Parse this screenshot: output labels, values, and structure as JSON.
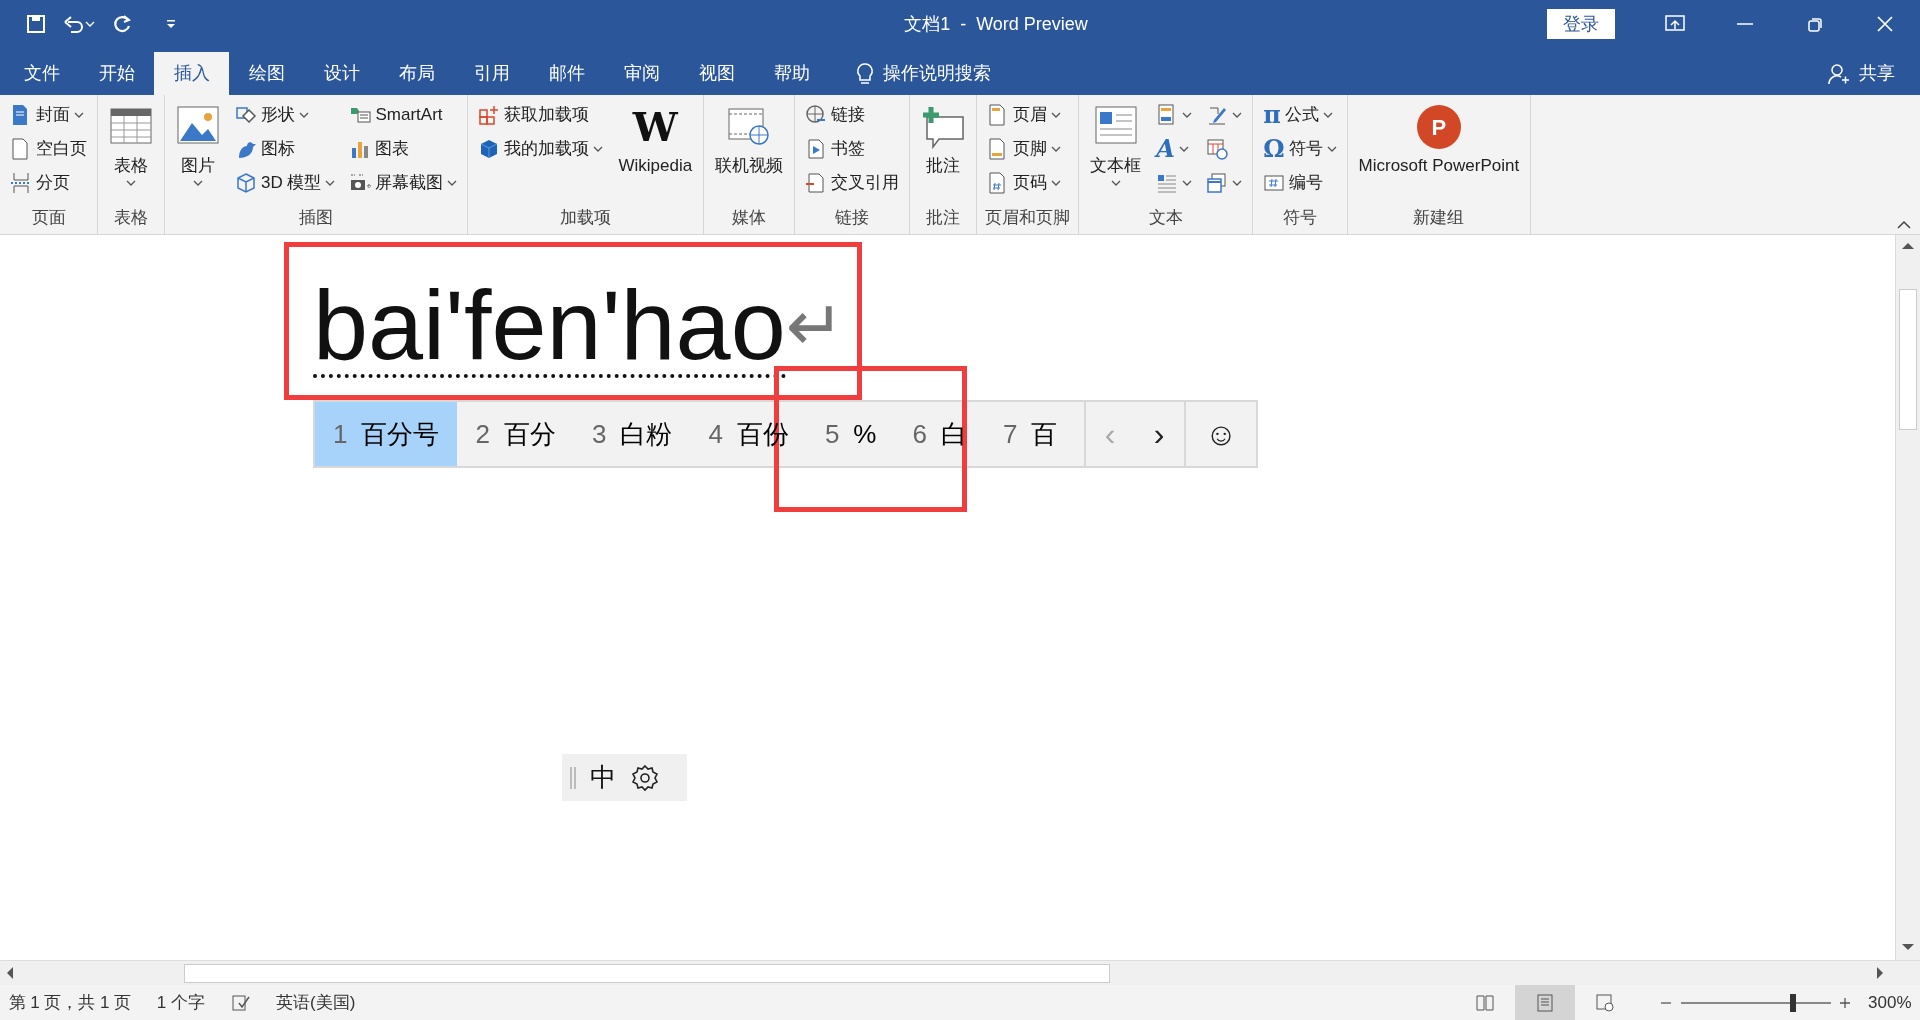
{
  "window": {
    "title": "文档1  -  Word Preview",
    "login_button": "登录"
  },
  "tabs": [
    {
      "label": "文件",
      "selected": false
    },
    {
      "label": "开始",
      "selected": false
    },
    {
      "label": "插入",
      "selected": true
    },
    {
      "label": "绘图",
      "selected": false
    },
    {
      "label": "设计",
      "selected": false
    },
    {
      "label": "布局",
      "selected": false
    },
    {
      "label": "引用",
      "selected": false
    },
    {
      "label": "邮件",
      "selected": false
    },
    {
      "label": "审阅",
      "selected": false
    },
    {
      "label": "视图",
      "selected": false
    },
    {
      "label": "帮助",
      "selected": false
    }
  ],
  "tell_me": "操作说明搜索",
  "share": "共享",
  "ribbon": {
    "groups": [
      {
        "label": "页面",
        "items": [
          {
            "label": "封面",
            "kind": "small",
            "dropdown": true
          },
          {
            "label": "空白页",
            "kind": "small",
            "dropdown": false
          },
          {
            "label": "分页",
            "kind": "small",
            "dropdown": false
          }
        ]
      },
      {
        "label": "表格",
        "items": [
          {
            "label": "表格",
            "kind": "large",
            "dropdown": true
          }
        ]
      },
      {
        "label": "插图",
        "items": [
          {
            "label": "图片",
            "kind": "large",
            "dropdown": true
          },
          {
            "label": "形状",
            "kind": "small",
            "dropdown": true
          },
          {
            "label": "图标",
            "kind": "small",
            "dropdown": false
          },
          {
            "label": "3D 模型",
            "kind": "small",
            "dropdown": true
          },
          {
            "label": "SmartArt",
            "kind": "small",
            "dropdown": false
          },
          {
            "label": "图表",
            "kind": "small",
            "dropdown": false
          },
          {
            "label": "屏幕截图",
            "kind": "small",
            "dropdown": true
          }
        ]
      },
      {
        "label": "加载项",
        "items": [
          {
            "label": "获取加载项",
            "kind": "small",
            "dropdown": false
          },
          {
            "label": "我的加载项",
            "kind": "small",
            "dropdown": true
          },
          {
            "label": "Wikipedia",
            "kind": "large",
            "dropdown": false,
            "glyph": "W"
          }
        ]
      },
      {
        "label": "媒体",
        "items": [
          {
            "label": "联机视频",
            "kind": "large",
            "dropdown": false
          }
        ]
      },
      {
        "label": "链接",
        "items": [
          {
            "label": "链接",
            "kind": "small",
            "dropdown": false
          },
          {
            "label": "书签",
            "kind": "small",
            "dropdown": false
          },
          {
            "label": "交叉引用",
            "kind": "small",
            "dropdown": false
          }
        ]
      },
      {
        "label": "批注",
        "items": [
          {
            "label": "批注",
            "kind": "large",
            "dropdown": false
          }
        ]
      },
      {
        "label": "页眉和页脚",
        "items": [
          {
            "label": "页眉",
            "kind": "small",
            "dropdown": true
          },
          {
            "label": "页脚",
            "kind": "small",
            "dropdown": true
          },
          {
            "label": "页码",
            "kind": "small",
            "dropdown": true
          }
        ]
      },
      {
        "label": "文本",
        "items": [
          {
            "label": "文本框",
            "kind": "large",
            "dropdown": true
          },
          {
            "kind": "small",
            "dropdown": true
          },
          {
            "kind": "small",
            "dropdown": true,
            "glyph": "A"
          },
          {
            "kind": "small",
            "dropdown": true
          },
          {
            "kind": "small",
            "dropdown": true
          },
          {
            "kind": "small",
            "dropdown": false
          },
          {
            "kind": "small",
            "dropdown": true
          }
        ]
      },
      {
        "label": "符号",
        "items": [
          {
            "label": "公式",
            "kind": "small",
            "dropdown": true,
            "glyph": "π"
          },
          {
            "label": "符号",
            "kind": "small",
            "dropdown": true,
            "glyph": "Ω"
          },
          {
            "label": "编号",
            "kind": "small",
            "dropdown": false
          }
        ]
      },
      {
        "label": "新建组",
        "items": [
          {
            "label": "Microsoft PowerPoint",
            "kind": "large",
            "dropdown": false,
            "glyph": "P"
          }
        ]
      }
    ]
  },
  "document": {
    "text": "bai'fen'hao",
    "paragraph_mark": "↵"
  },
  "candidates": {
    "items": [
      {
        "number": "1",
        "text": "百分号",
        "selected": true
      },
      {
        "number": "2",
        "text": "百分",
        "selected": false
      },
      {
        "number": "3",
        "text": "白粉",
        "selected": false
      },
      {
        "number": "4",
        "text": "百份",
        "selected": false
      },
      {
        "number": "5",
        "text": "%",
        "selected": false
      },
      {
        "number": "6",
        "text": "白",
        "selected": false
      },
      {
        "number": "7",
        "text": "百",
        "selected": false
      }
    ],
    "prev": {
      "glyph": "‹",
      "disabled": true
    },
    "next": {
      "glyph": "›",
      "disabled": false
    },
    "emoji": "☺"
  },
  "ime_bar": {
    "mode": "中"
  },
  "annotations": [
    {
      "kind": "frame"
    },
    {
      "kind": "frame"
    }
  ],
  "status_bar": {
    "page": "第 1 页，共 1 页",
    "words": "1 个字",
    "language": "英语(美国)",
    "views": [
      {
        "selected": false
      },
      {
        "selected": true
      },
      {
        "selected": false
      }
    ],
    "zoom": {
      "level": 0.73,
      "reading": "300%"
    }
  }
}
